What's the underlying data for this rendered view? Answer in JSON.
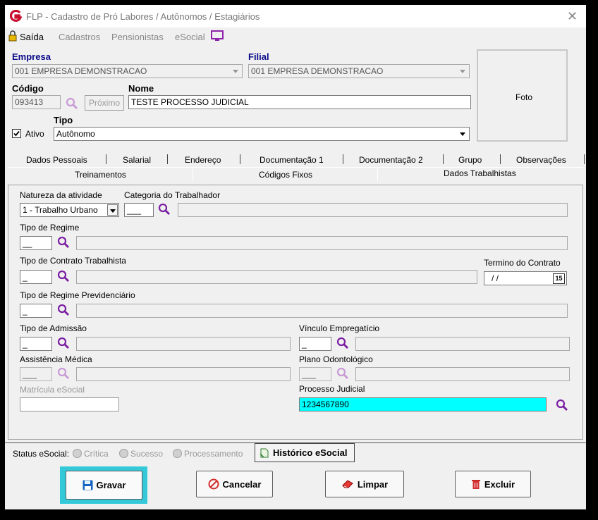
{
  "window": {
    "title": "FLP - Cadastro de Pró Labores / Autônomos / Estagiários"
  },
  "menu": {
    "saida": "Saída",
    "cadastros": "Cadastros",
    "pensionistas": "Pensionistas",
    "esocial": "eSocial"
  },
  "header": {
    "empresa_label": "Empresa",
    "empresa_value": "001 EMPRESA DEMONSTRACAO",
    "filial_label": "Filial",
    "filial_value": "001 EMPRESA DEMONSTRACAO",
    "codigo_label": "Código",
    "codigo_value": "093413",
    "proximo_label": "Próximo",
    "nome_label": "Nome",
    "nome_value": "TESTE PROCESSO JUDICIAL",
    "ativo_label": "Ativo",
    "tipo_label": "Tipo",
    "tipo_value": "Autônomo",
    "foto_label": "Foto"
  },
  "tabs_row1": [
    "Dados Pessoais",
    "Salarial",
    "Endereço",
    "Documentação 1",
    "Documentação 2",
    "Grupo",
    "Observações"
  ],
  "tabs_row2": [
    "Treinamentos",
    "Códigos Fixos",
    "Dados Trabalhistas"
  ],
  "form": {
    "natureza_label": "Natureza da atividade",
    "natureza_value": "1 - Trabalho Urbano",
    "categoria_label": "Categoria do Trabalhador",
    "categoria_code": "___",
    "regime_label": "Tipo de Regime",
    "regime_code": "__",
    "contrato_label": "Tipo de Contrato Trabalhista",
    "contrato_code": "_",
    "termino_label": "Termino do Contrato",
    "termino_value": "/  /",
    "calendar_day": "15",
    "previdenciario_label": "Tipo de Regime Previdenciário",
    "previdenciario_code": "_",
    "admissao_label": "Tipo de Admissão",
    "admissao_code": "_",
    "vinculo_label": "Vínculo Empregatício",
    "vinculo_code": "_",
    "assistencia_label": "Assistência Médica",
    "assistencia_code": "___",
    "odontologico_label": "Plano Odontológico",
    "odontologico_code": "___",
    "matricula_label": "Matrícula eSocial",
    "matricula_value": "",
    "processo_label": "Processo Judicial",
    "processo_value": "1234567890"
  },
  "status": {
    "label": "Status eSocial:",
    "critica": "Crítica",
    "sucesso": "Sucesso",
    "processamento": "Processamento",
    "historico": "Histórico eSocial"
  },
  "buttons": {
    "gravar": "Gravar",
    "cancelar": "Cancelar",
    "limpar": "Limpar",
    "excluir": "Excluir"
  },
  "colors": {
    "logo": "#c8102e",
    "accent_purple": "#7b1fa2",
    "highlight_cyan": "#00ffff",
    "focus_glow": "#33c9d9"
  }
}
